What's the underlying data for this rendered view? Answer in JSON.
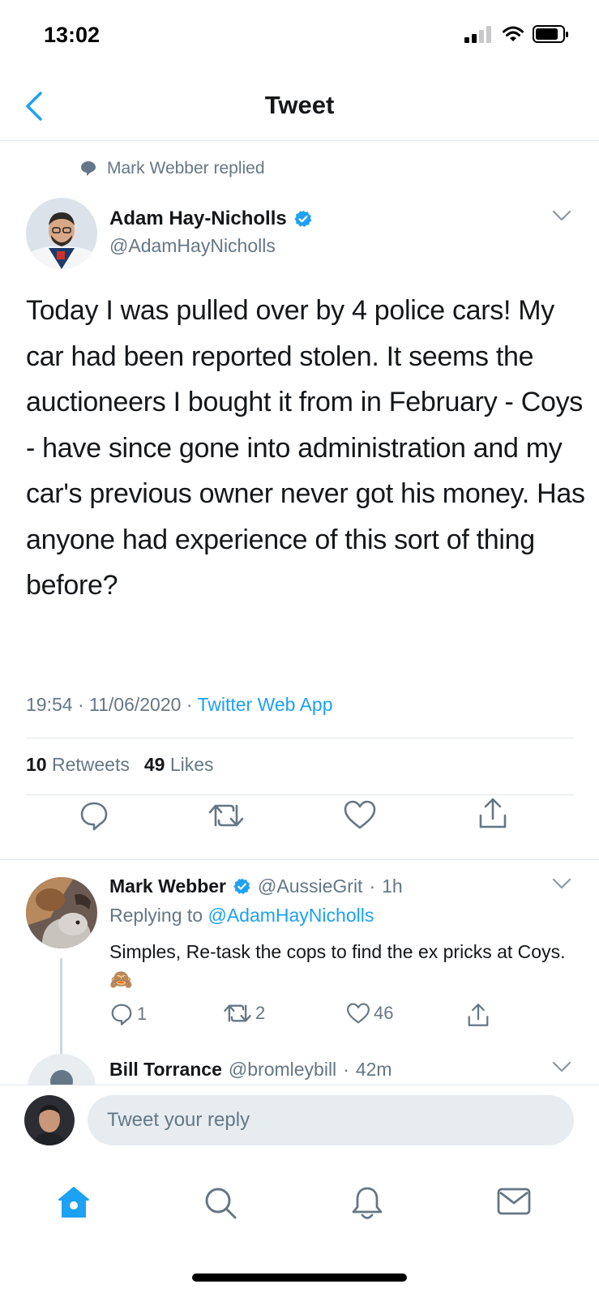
{
  "status_bar": {
    "time": "13:02"
  },
  "nav": {
    "title": "Tweet"
  },
  "context": {
    "text": "Mark Webber replied"
  },
  "tweet": {
    "author_name": "Adam Hay-Nicholls",
    "author_handle": "@AdamHayNicholls",
    "text": "Today I was pulled over by 4 police cars! My car had been reported stolen. It seems the auctioneers I bought it from in February - Coys - have since gone into administration and my car's previous owner never got his money. Has anyone had experience of this sort of thing before?",
    "time": "19:54",
    "date": "11/06/2020",
    "app": "Twitter Web App",
    "retweets_count": "10",
    "retweets_label": "Retweets",
    "likes_count": "49",
    "likes_label": "Likes"
  },
  "reply": {
    "author_name": "Mark Webber",
    "author_handle": "@AussieGrit",
    "age": "1h",
    "replying_prefix": "Replying to",
    "replying_to": "@AdamHayNicholls",
    "text": "Simples, Re-task the cops to find the ex pricks at Coys. 🙈",
    "reply_count": "1",
    "retweet_count": "2",
    "like_count": "46"
  },
  "next_reply": {
    "author_name": "Bill Torrance",
    "author_handle": "@bromleybill",
    "age": "42m"
  },
  "compose": {
    "placeholder": "Tweet your reply"
  },
  "colors": {
    "accent": "#1da1f2",
    "secondary_text": "#657786",
    "primary_text": "#14171a",
    "border": "#e1e8ed"
  }
}
